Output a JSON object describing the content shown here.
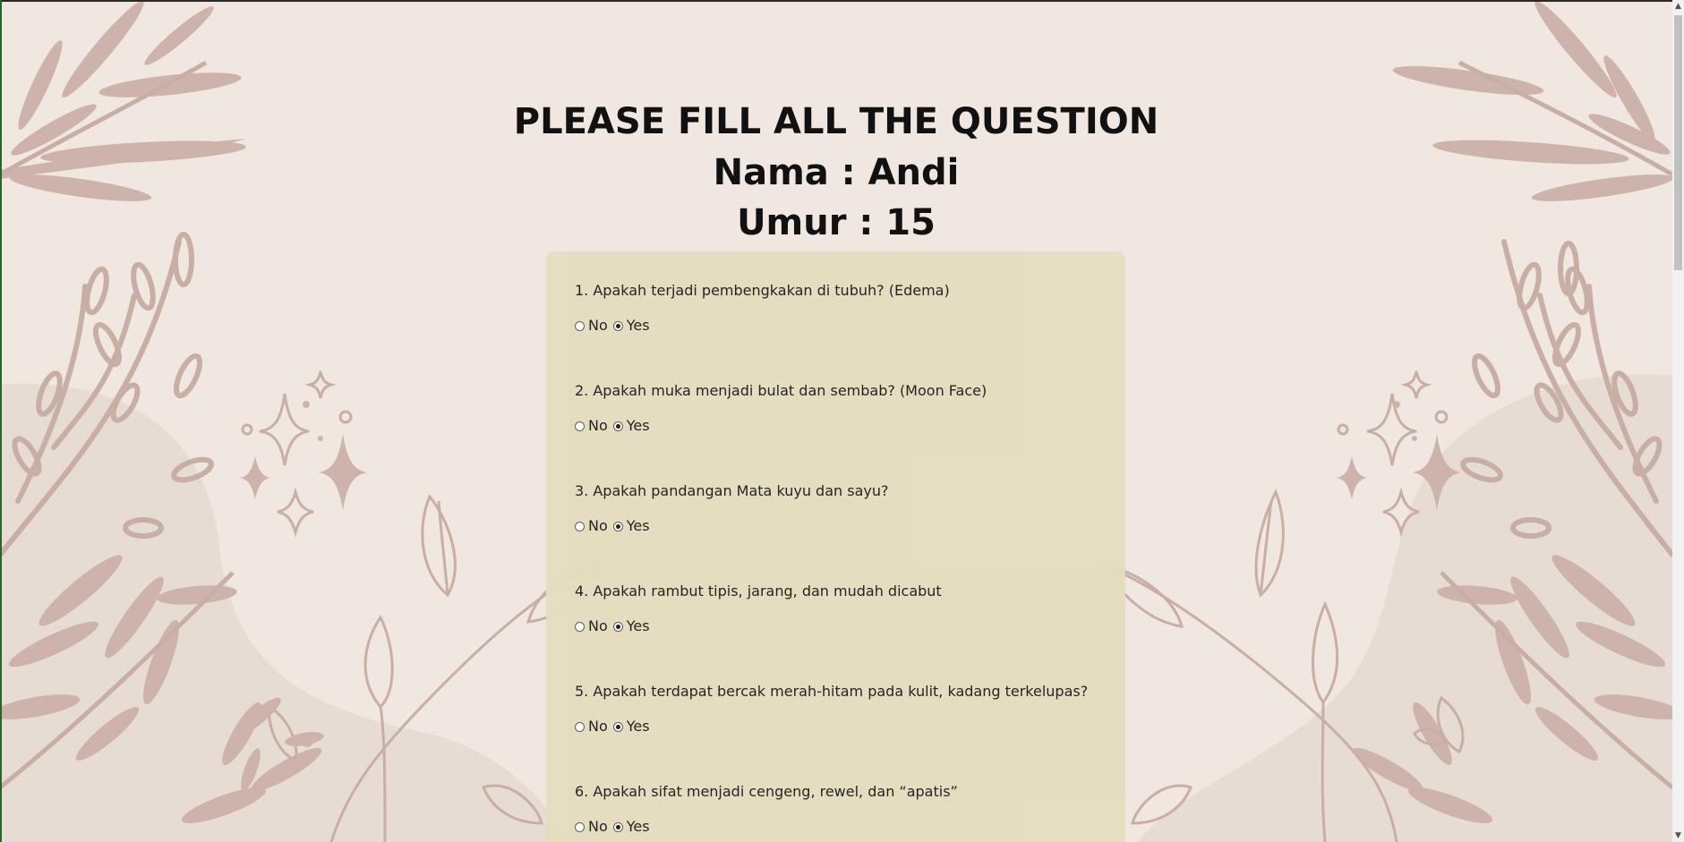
{
  "header": {
    "title": "PLEASE FILL ALL THE QUESTION",
    "name_line": "Nama : Andi",
    "age_line": "Umur : 15"
  },
  "form": {
    "questions": [
      {
        "text": "1. Apakah terjadi pembengkakan di tubuh? (Edema)",
        "options": [
          "No",
          "Yes"
        ],
        "selected": "Yes"
      },
      {
        "text": "2. Apakah muka menjadi bulat dan sembab? (Moon Face)",
        "options": [
          "No",
          "Yes"
        ],
        "selected": "Yes"
      },
      {
        "text": "3. Apakah pandangan Mata kuyu dan sayu?",
        "options": [
          "No",
          "Yes"
        ],
        "selected": "Yes"
      },
      {
        "text": "4. Apakah rambut tipis, jarang, dan mudah dicabut",
        "options": [
          "No",
          "Yes"
        ],
        "selected": "Yes"
      },
      {
        "text": "5. Apakah terdapat bercak merah-hitam pada kulit, kadang terkelupas?",
        "options": [
          "No",
          "Yes"
        ],
        "selected": "Yes"
      },
      {
        "text": "6. Apakah sifat menjadi cengeng, rewel, dan “apatis”",
        "options": [
          "No",
          "Yes"
        ],
        "selected": "Yes"
      }
    ]
  },
  "colors": {
    "page_background": "#f0e7e1",
    "card_background": "#e4ddbf",
    "leaf_fill": "#cdb3ac",
    "leaf_stroke": "#c9aea6",
    "blob": "#e7dcd4"
  },
  "scrollbar": {
    "up_icon": "scroll-up-arrow-icon",
    "down_icon": "scroll-down-arrow-icon"
  }
}
